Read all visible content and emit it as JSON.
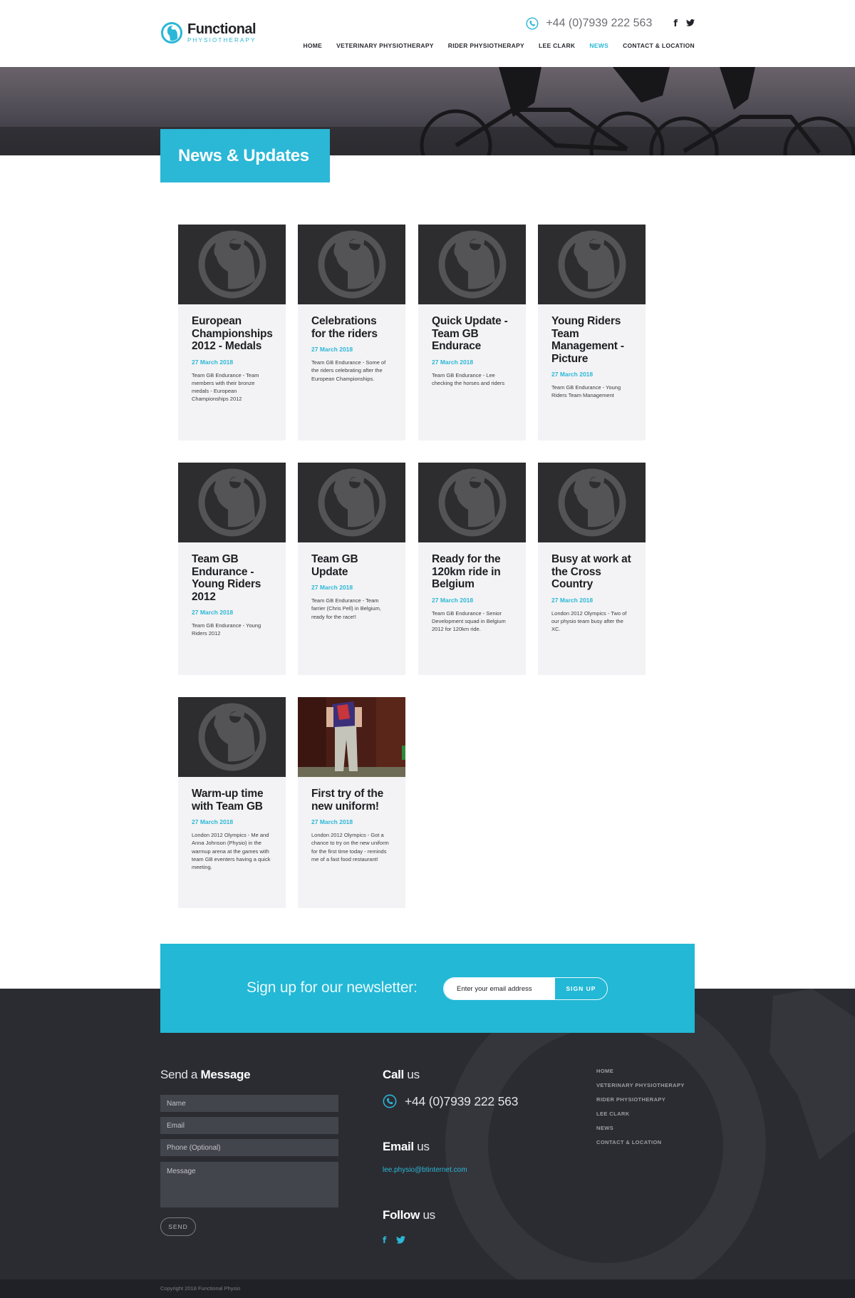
{
  "brand": {
    "name": "Functional",
    "tagline": "PHYSIOTHERAPY"
  },
  "header": {
    "phone": "+44 (0)7939 222 563",
    "social": [
      "f",
      "t"
    ],
    "nav": [
      {
        "label": "HOME",
        "active": false
      },
      {
        "label": "VETERINARY PHYSIOTHERAPY",
        "active": false
      },
      {
        "label": "RIDER PHYSIOTHERAPY",
        "active": false
      },
      {
        "label": "LEE CLARK",
        "active": false
      },
      {
        "label": "NEWS",
        "active": true
      },
      {
        "label": "CONTACT & LOCATION",
        "active": false
      }
    ]
  },
  "page": {
    "title": "News & Updates"
  },
  "articles": [
    {
      "title": "European Championships 2012 - Medals",
      "date": "27 March 2018",
      "summary": "Team GB Endurance - Team members with their bronze medals - European Championships 2012",
      "image": "logo-placeholder"
    },
    {
      "title": "Celebrations for the riders",
      "date": "27 March 2018",
      "summary": "Team GB Endurance - Some of the riders celebrating after the European Championships.",
      "image": "logo-placeholder"
    },
    {
      "title": "Quick Update - Team GB Endurace",
      "date": "27 March 2018",
      "summary": "Team GB Endurance - Lee checking the horses and riders",
      "image": "logo-placeholder"
    },
    {
      "title": "Young Riders Team Management - Picture",
      "date": "27 March 2018",
      "summary": "Team GB Endurance - Young Riders Team Management",
      "image": "logo-placeholder"
    },
    {
      "title": "Team GB Endurance - Young Riders 2012",
      "date": "27 March 2018",
      "summary": "Team GB Endurance - Young Riders 2012",
      "image": "logo-placeholder"
    },
    {
      "title": "Team GB Update",
      "date": "27 March 2018",
      "summary": "Team GB Endurance - Team farrier (Chris Pell) in Belgium, ready for the race!!",
      "image": "logo-placeholder"
    },
    {
      "title": "Ready for the 120km ride in Belgium",
      "date": "27 March 2018",
      "summary": "Team GB Endurance - Senior Development squad in Belgium 2012 for 120km ride.",
      "image": "logo-placeholder"
    },
    {
      "title": "Busy at work at the Cross Country",
      "date": "27 March 2018",
      "summary": "London 2012 Olympics - Two of our physio team busy after the XC.",
      "image": "logo-placeholder"
    },
    {
      "title": "Warm-up time with Team GB",
      "date": "27 March 2018",
      "summary": "London 2012 Olympics - Me and Anna Johnson (Physio) in the warmup arena at the games with team GB eventers having a quick meeting.",
      "image": "logo-placeholder"
    },
    {
      "title": "First try of the new uniform!",
      "date": "27 March 2018",
      "summary": "London 2012 Olympics - Got a chance to try on the new uniform for the first time today - reminds me of a fast food restaurant!",
      "image": "photo"
    }
  ],
  "newsletter": {
    "label": "Sign up for our newsletter:",
    "placeholder": "Enter your email address",
    "button": "SIGN UP"
  },
  "footer": {
    "message": {
      "heading_light": "Send a",
      "heading_bold": "Message",
      "name_placeholder": "Name",
      "email_placeholder": "Email",
      "phone_placeholder": "Phone (Optional)",
      "message_placeholder": "Message",
      "send": "SEND"
    },
    "call": {
      "heading_bold": "Call",
      "heading_light": "us",
      "phone": "+44 (0)7939 222 563"
    },
    "email": {
      "heading_bold": "Email",
      "heading_light": "us",
      "address": "lee.physio@btinternet.com"
    },
    "follow": {
      "heading_bold": "Follow",
      "heading_light": "us",
      "social": [
        "f",
        "t"
      ]
    },
    "nav": [
      "HOME",
      "VETERINARY PHYSIOTHERAPY",
      "RIDER PHYSIOTHERAPY",
      "LEE CLARK",
      "NEWS",
      "CONTACT & LOCATION"
    ],
    "copyright": "Copyright 2018 Functional Physio"
  },
  "colors": {
    "accent": "#2bb7d6",
    "dark": "#2b2c32",
    "card_bg": "#f3f3f5"
  }
}
